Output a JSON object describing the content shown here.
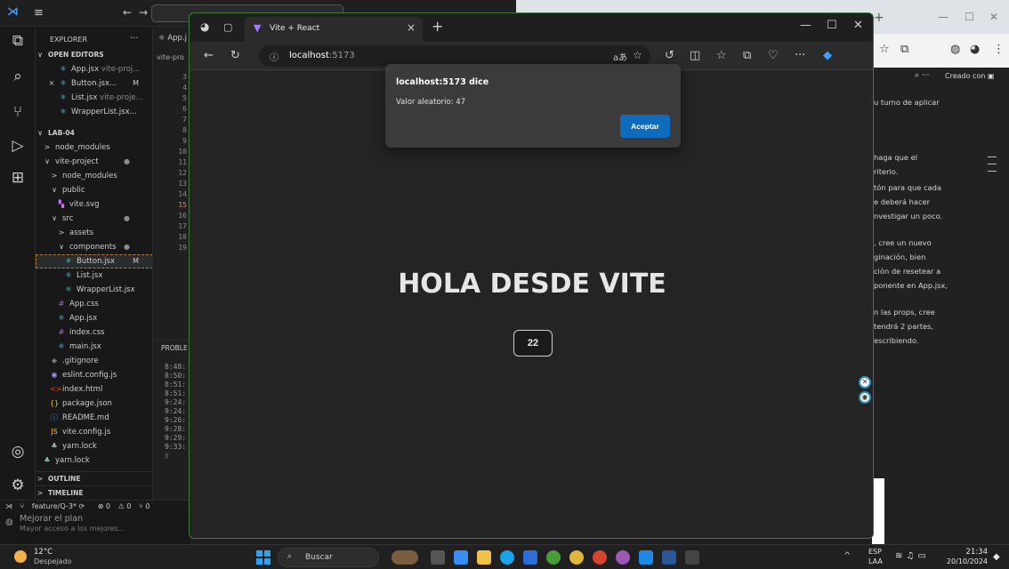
{
  "vscode": {
    "explorer_title": "EXPLORER",
    "more": "···",
    "open_editors_label": "OPEN EDITORS",
    "open_editors": [
      {
        "icon": "⚛",
        "name": "App.jsx",
        "hint": "vite-proj...",
        "badge": "",
        "close": ""
      },
      {
        "icon": "⚛",
        "name": "Button.jsx...",
        "hint": "",
        "badge": "M",
        "close": "×"
      },
      {
        "icon": "⚛",
        "name": "List.jsx",
        "hint": "vite-proje...",
        "badge": "",
        "close": ""
      },
      {
        "icon": "⚛",
        "name": "WrapperList.jsx...",
        "hint": "",
        "badge": "",
        "close": ""
      }
    ],
    "workspace_label": "LAB-04",
    "tree": [
      {
        "chev": ">",
        "name": "node_modules"
      },
      {
        "chev": "∨",
        "name": "vite-project",
        "dot": "●"
      },
      {
        "chev": ">",
        "name": "node_modules"
      },
      {
        "chev": "∨",
        "name": "public"
      },
      {
        "icon": "▚",
        "name": "vite.svg"
      },
      {
        "chev": "∨",
        "name": "src",
        "dot": "●"
      },
      {
        "chev": ">",
        "name": "assets"
      },
      {
        "chev": "∨",
        "name": "components",
        "dot": "●"
      },
      {
        "icon": "⚛",
        "name": "Button.jsx",
        "badge": "M"
      },
      {
        "icon": "⚛",
        "name": "List.jsx"
      },
      {
        "icon": "⚛",
        "name": "WrapperList.jsx"
      },
      {
        "icon": "#",
        "name": "App.css"
      },
      {
        "icon": "⚛",
        "name": "App.jsx"
      },
      {
        "icon": "#",
        "name": "index.css"
      },
      {
        "icon": "⚛",
        "name": "main.jsx"
      },
      {
        "icon": "◈",
        "name": ".gitignore"
      },
      {
        "icon": "◉",
        "name": "eslint.config.js"
      },
      {
        "icon": "<>",
        "name": "index.html"
      },
      {
        "icon": "{}",
        "name": "package.json"
      },
      {
        "icon": "ⓘ",
        "name": "README.md"
      },
      {
        "icon": "JS",
        "name": "vite.config.js"
      },
      {
        "icon": "♣",
        "name": "yarn.lock"
      },
      {
        "icon": "♣",
        "name": "yarn.lock"
      }
    ],
    "outline_label": "OUTLINE",
    "timeline_label": "TIMELINE",
    "editor_tab": "⚛ App.j",
    "editor_crumb": "vite-pro",
    "line_numbers": [
      "3",
      "4",
      "5",
      "6",
      "7",
      "8",
      "9",
      "10",
      "11",
      "12",
      "13",
      "14",
      "15",
      "16",
      "17",
      "18",
      "19"
    ],
    "current_line": "15",
    "panel_label": "PROBLE",
    "terminal_lines": [
      "8:48:",
      "8:50:",
      "8:51:",
      "8:51:",
      "9:24:",
      "9:24:",
      "9:26:",
      "9:28:",
      "9:29:",
      "9:33:",
      "▯"
    ],
    "status": {
      "branch": "feature/Q-3*",
      "errors": "⊗ 0",
      "warnings": "⚠ 0",
      "ports": "⑂ 0"
    }
  },
  "chatgpt_strip": {
    "title": "Mejorar el plan",
    "subtitle": "Mayor acceso a los mejores..."
  },
  "bg_page": {
    "creado": "Creado con",
    "lines": [
      "u turno de aplicar",
      "haga que el",
      "riterio.",
      "tón para que cada",
      "e deberá hacer",
      "nvestigar un poco.",
      ", cree un nuevo",
      "ginación, bien",
      "ción de resetear a",
      "ponente en App.jsx,",
      "n las props, cree",
      "tendrá 2 partes,",
      "escribiendo."
    ]
  },
  "edge": {
    "tab_title": "Vite + React",
    "url_host": "localhost",
    "url_port": ":5173",
    "heading": "HOLA DESDE VITE",
    "counter_value": "22",
    "dialog": {
      "title": "localhost:5173 dice",
      "message": "Valor aleatorio: 47",
      "button": "Aceptar"
    }
  },
  "taskbar": {
    "temp": "12°C",
    "condition": "Despejado",
    "search_label": "Buscar",
    "lang1": "ESP",
    "lang2": "LAA",
    "time": "21:34",
    "date": "20/10/2024"
  }
}
